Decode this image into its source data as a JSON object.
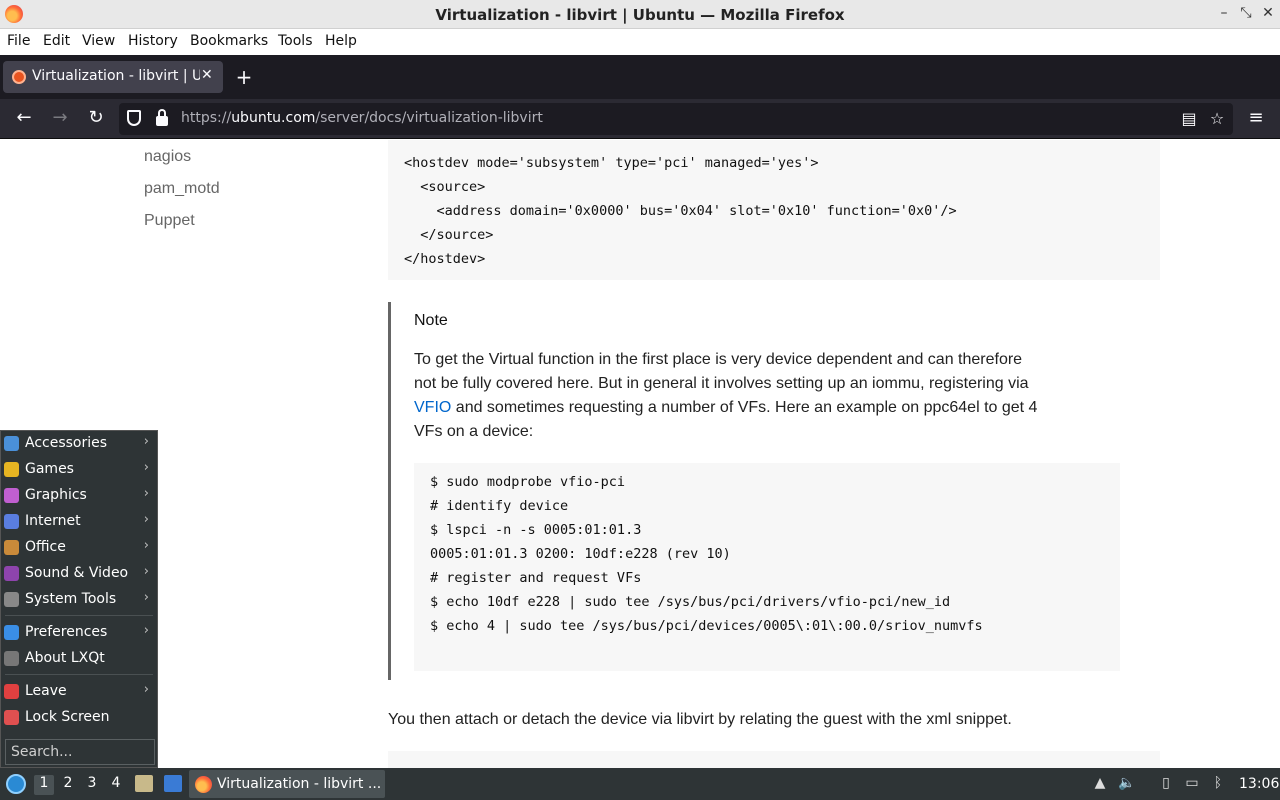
{
  "window": {
    "title": "Virtualization - libvirt | Ubuntu — Mozilla Firefox"
  },
  "menu": [
    "File",
    "Edit",
    "View",
    "History",
    "Bookmarks",
    "Tools",
    "Help"
  ],
  "tab": {
    "title": "Virtualization - libvirt | Ubuntu",
    "close_glyph": "✕",
    "new_tab_glyph": "+"
  },
  "url": {
    "scheme": "https://",
    "domain": "ubuntu.com",
    "path": "/server/docs/virtualization-libvirt"
  },
  "sidebar_links": [
    "nagios",
    "pam_motd",
    "Puppet"
  ],
  "code_block_1": [
    "<hostdev mode='subsystem' type='pci' managed='yes'>",
    "  <source>",
    "    <address domain='0x0000' bus='0x04' slot='0x10' function='0x0'/>",
    "  </source>",
    "</hostdev>"
  ],
  "note": {
    "title": "Note",
    "body_pre": "To get the Virtual function in the first place is very device dependent and can therefore not be fully covered here. But in general it involves setting up an iommu, registering via ",
    "link": "VFIO",
    "body_post": " and sometimes requesting a number of VFs. Here an example on ppc64el to get 4 VFs on a device:"
  },
  "code_block_2": [
    "$ sudo modprobe vfio-pci",
    "# identify device",
    "$ lspci -n -s 0005:01:01.3",
    "0005:01:01.3 0200: 10df:e228 (rev 10)",
    "# register and request VFs",
    "$ echo 10df e228 | sudo tee /sys/bus/pci/drivers/vfio-pci/new_id",
    "$ echo 4 | sudo tee /sys/bus/pci/devices/0005\\:01\\:00.0/sriov_numvfs"
  ],
  "after_text": "You then attach or detach the device via libvirt by relating the guest with the xml snippet.",
  "start_menu": {
    "items": [
      {
        "label": "Accessories",
        "icon": "accessories-icon",
        "color": "#4a90d9",
        "submenu": true
      },
      {
        "label": "Games",
        "icon": "games-icon",
        "color": "#e6b422",
        "submenu": true
      },
      {
        "label": "Graphics",
        "icon": "graphics-icon",
        "color": "#c05fd0",
        "submenu": true
      },
      {
        "label": "Internet",
        "icon": "internet-icon",
        "color": "#5a7ee0",
        "submenu": true
      },
      {
        "label": "Office",
        "icon": "office-icon",
        "color": "#c98a3a",
        "submenu": true
      },
      {
        "label": "Sound & Video",
        "icon": "sound-video-icon",
        "color": "#8e44ad",
        "submenu": true
      },
      {
        "label": "System Tools",
        "icon": "system-tools-icon",
        "color": "#888888",
        "submenu": true
      },
      {
        "label": "Preferences",
        "icon": "preferences-icon",
        "color": "#3a8ee6",
        "submenu": true
      },
      {
        "label": "About LXQt",
        "icon": "about-icon",
        "color": "#777777",
        "submenu": false
      },
      {
        "label": "Leave",
        "icon": "leave-icon",
        "color": "#e04040",
        "submenu": true
      },
      {
        "label": "Lock Screen",
        "icon": "lock-screen-icon",
        "color": "#e05050",
        "submenu": false
      }
    ],
    "arrow_glyph": "›",
    "search_placeholder": "Search..."
  },
  "taskbar": {
    "desktops": [
      "1",
      "2",
      "3",
      "4"
    ],
    "active_desktop": "1",
    "task_label": "Virtualization - libvirt ...",
    "clock": "13:06"
  }
}
